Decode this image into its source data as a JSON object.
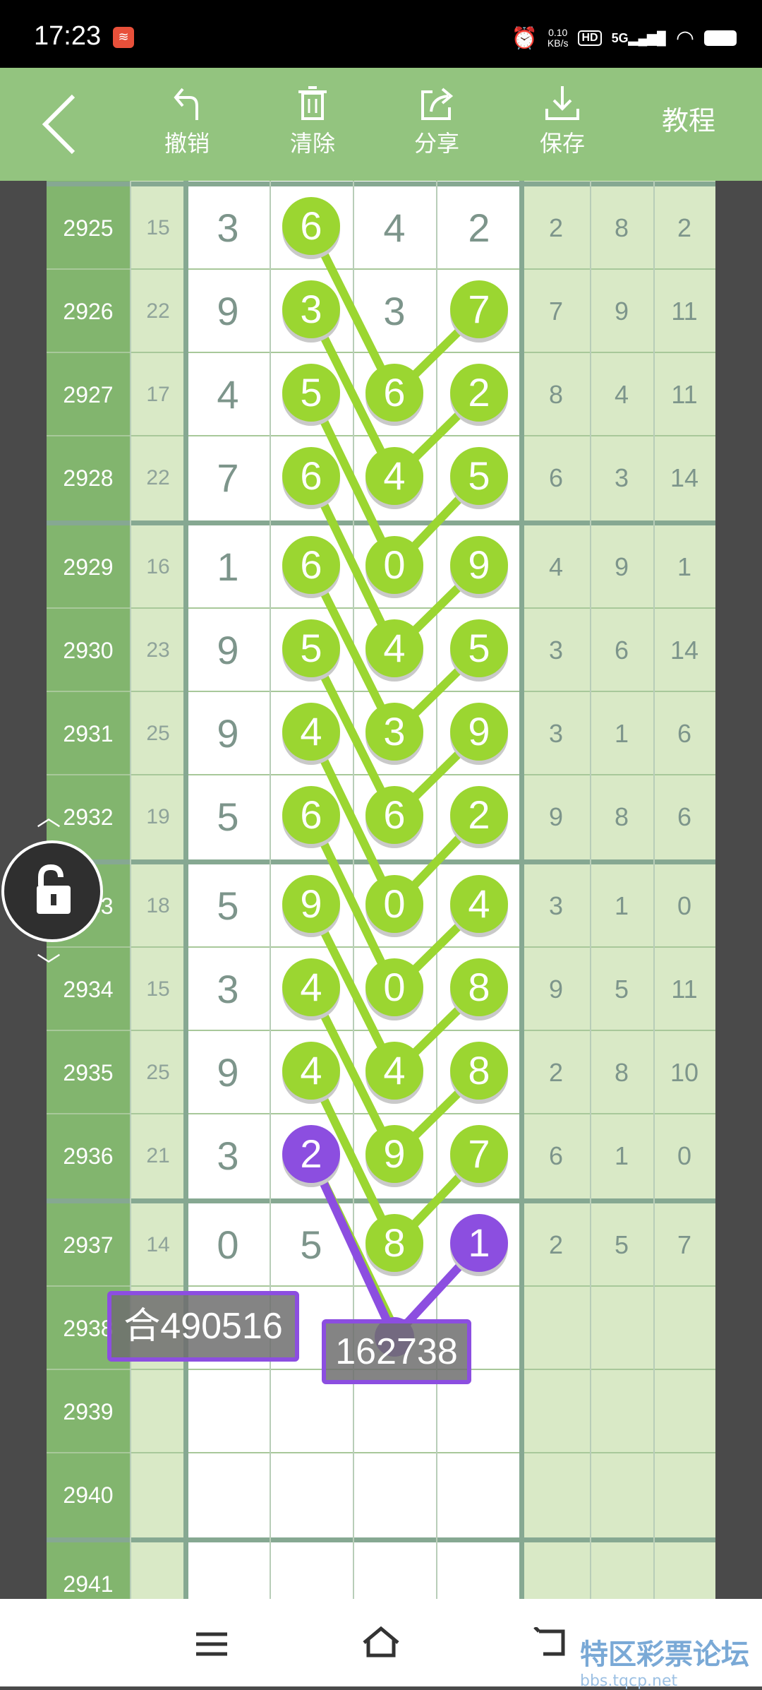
{
  "status": {
    "time": "17:23",
    "speed": "0.10\nKB/s",
    "speed_top": "0.10",
    "speed_bottom": "KB/s",
    "hd": "HD",
    "network": "5G"
  },
  "toolbar": {
    "undo": "撤销",
    "clear": "清除",
    "share": "分享",
    "save": "保存",
    "tutorial": "教程"
  },
  "rows": [
    {
      "issue": "2925",
      "sum": "15",
      "digits": [
        "3",
        "6",
        "4",
        "2"
      ],
      "right": [
        "2",
        "8",
        "2"
      ]
    },
    {
      "issue": "2926",
      "sum": "22",
      "digits": [
        "9",
        "3",
        "3",
        "7"
      ],
      "right": [
        "7",
        "9",
        "11"
      ]
    },
    {
      "issue": "2927",
      "sum": "17",
      "digits": [
        "4",
        "5",
        "6",
        "2"
      ],
      "right": [
        "8",
        "4",
        "11"
      ]
    },
    {
      "issue": "2928",
      "sum": "22",
      "digits": [
        "7",
        "6",
        "4",
        "5"
      ],
      "right": [
        "6",
        "3",
        "14"
      ]
    },
    {
      "issue": "2929",
      "sum": "16",
      "digits": [
        "1",
        "6",
        "0",
        "9"
      ],
      "right": [
        "4",
        "9",
        "1"
      ]
    },
    {
      "issue": "2930",
      "sum": "23",
      "digits": [
        "9",
        "5",
        "4",
        "5"
      ],
      "right": [
        "3",
        "6",
        "14"
      ]
    },
    {
      "issue": "2931",
      "sum": "25",
      "digits": [
        "9",
        "4",
        "3",
        "9"
      ],
      "right": [
        "3",
        "1",
        "6"
      ]
    },
    {
      "issue": "2932",
      "sum": "19",
      "digits": [
        "5",
        "6",
        "6",
        "2"
      ],
      "right": [
        "9",
        "8",
        "6"
      ]
    },
    {
      "issue": "2933",
      "sum": "18",
      "digits": [
        "5",
        "9",
        "0",
        "4"
      ],
      "right": [
        "3",
        "1",
        "0"
      ]
    },
    {
      "issue": "2934",
      "sum": "15",
      "digits": [
        "3",
        "4",
        "0",
        "8"
      ],
      "right": [
        "9",
        "5",
        "11"
      ]
    },
    {
      "issue": "2935",
      "sum": "25",
      "digits": [
        "9",
        "4",
        "4",
        "8"
      ],
      "right": [
        "2",
        "8",
        "10"
      ]
    },
    {
      "issue": "2936",
      "sum": "21",
      "digits": [
        "3",
        "2",
        "9",
        "7"
      ],
      "right": [
        "6",
        "1",
        "0"
      ]
    },
    {
      "issue": "2937",
      "sum": "14",
      "digits": [
        "0",
        "5",
        "8",
        "1"
      ],
      "right": [
        "2",
        "5",
        "7"
      ]
    },
    {
      "issue": "2938",
      "sum": "",
      "digits": [
        "",
        "",
        "",
        ""
      ],
      "right": [
        "",
        "",
        ""
      ]
    },
    {
      "issue": "2939",
      "sum": "",
      "digits": [
        "",
        "",
        "",
        ""
      ],
      "right": [
        "",
        "",
        ""
      ]
    },
    {
      "issue": "2940",
      "sum": "",
      "digits": [
        "",
        "",
        "",
        ""
      ],
      "right": [
        "",
        "",
        ""
      ]
    },
    {
      "issue": "2941",
      "sum": "",
      "digits": [
        "",
        "",
        "",
        ""
      ],
      "right": [
        "",
        "",
        ""
      ]
    }
  ],
  "labels": {
    "left": "合490516",
    "center": "162738"
  },
  "watermark": {
    "text": "特区彩票论坛",
    "sub": "bbs.tqcp.net"
  },
  "colors": {
    "toolbar": "#93c47f",
    "ball_green": "#9bd631",
    "ball_purple": "#8c4ee0"
  }
}
